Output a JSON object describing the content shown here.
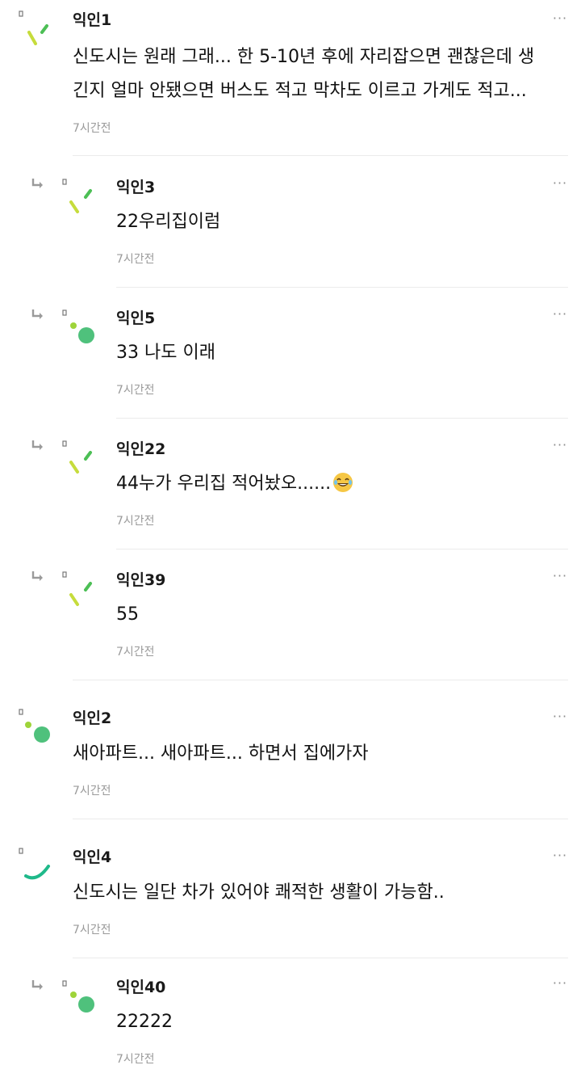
{
  "comments": [
    {
      "nick": "익인1",
      "lines": [
        "신도시는 원래 그래... 한 5-10년 후에 자리잡으면 괜찮은데 생",
        "긴지 얼마 안됐으면 버스도 적고 막차도 이르고 가게도 적고..."
      ],
      "time": "7시간전",
      "is_reply": false,
      "avatar_icon": "slash-dash-avatar-icon"
    },
    {
      "nick": "익인3",
      "lines": [
        "22우리집이럼"
      ],
      "time": "7시간전",
      "is_reply": true,
      "avatar_icon": "slash-dash-avatar-icon"
    },
    {
      "nick": "익인5",
      "lines": [
        "33 나도 이래"
      ],
      "time": "7시간전",
      "is_reply": true,
      "avatar_icon": "dot-circle-avatar-icon"
    },
    {
      "nick": "익인22",
      "lines": [
        "44누가 우리집 적어놨오......"
      ],
      "time": "7시간전",
      "is_reply": true,
      "avatar_icon": "slash-dash-avatar-icon",
      "emoji_icon": "laughing-tears-emoji-icon"
    },
    {
      "nick": "익인39",
      "lines": [
        "55"
      ],
      "time": "7시간전",
      "is_reply": true,
      "avatar_icon": "slash-dash-avatar-icon"
    },
    {
      "nick": "익인2",
      "lines": [
        "새아파트... 새아파트... 하면서 집에가자"
      ],
      "time": "7시간전",
      "is_reply": false,
      "avatar_icon": "dot-circle-avatar-icon"
    },
    {
      "nick": "익인4",
      "lines": [
        "신도시는 일단 차가 있어야 쾌적한 생활이 가능함.."
      ],
      "time": "7시간전",
      "is_reply": false,
      "avatar_icon": "smile-arc-avatar-icon"
    },
    {
      "nick": "익인40",
      "lines": [
        "22222"
      ],
      "time": "7시간전",
      "is_reply": true,
      "avatar_icon": "dot-circle-avatar-icon"
    }
  ],
  "colors": {
    "avatar_lime": "#c6dc3c",
    "avatar_green": "#4fc17c",
    "avatar_teal": "#1fb98a",
    "text": "#111111",
    "time": "#9a9a9a",
    "divider": "#ebebeb"
  },
  "more_icon": "more-dots-icon",
  "reply_icon": "reply-arrow-icon"
}
